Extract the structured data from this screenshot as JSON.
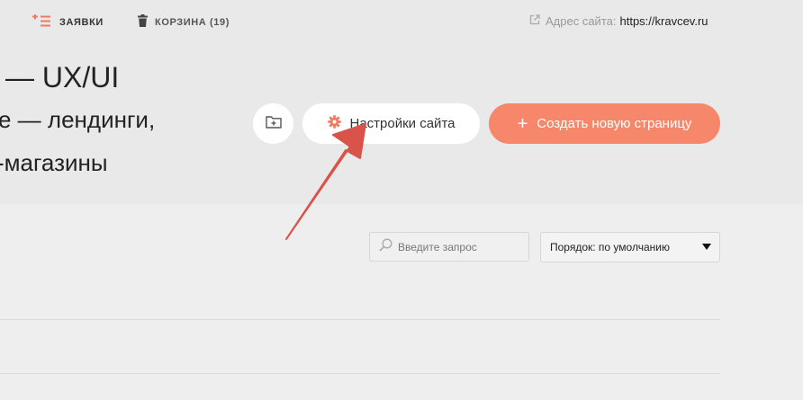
{
  "topbar": {
    "orders_label": "ЗАЯВКИ",
    "cart_label": "КОРЗИНА (19)",
    "site_address_label": "Адрес сайта:",
    "site_address_url": "https://kravcev.ru"
  },
  "hero": {
    "line1": "— UX/UI",
    "line2": "е — лендинги,",
    "line3": "-магазины"
  },
  "actions": {
    "settings_label": "Настройки сайта",
    "create_label": "Создать новую страницу"
  },
  "filters": {
    "search_placeholder": "Введите запрос",
    "sort_value": "Порядок: по умолчанию"
  },
  "colors": {
    "accent": "#f6876a",
    "annotation_arrow": "#d9534a"
  },
  "icons": {
    "orders": "list-plus-icon",
    "cart": "trash-icon",
    "external": "external-link-icon",
    "folder": "folder-plus-icon",
    "settings": "gear-icon",
    "search": "search-icon"
  }
}
